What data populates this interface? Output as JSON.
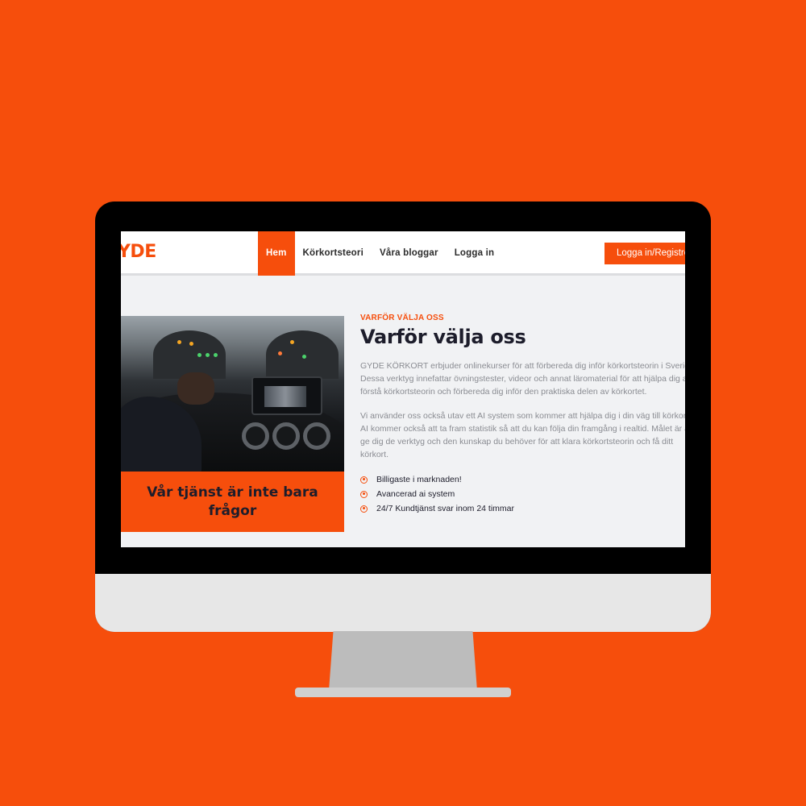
{
  "brand": {
    "logo_text": "YDE",
    "accent_color": "#f64e0c"
  },
  "nav": {
    "items": [
      {
        "label": "Hem",
        "active": true
      },
      {
        "label": "Körkortsteori",
        "active": false
      },
      {
        "label": "Våra bloggar",
        "active": false
      },
      {
        "label": "Logga in",
        "active": false
      }
    ],
    "cta_label": "Logga in/Registrera"
  },
  "hero": {
    "image_icon": "car-dashboard-photo",
    "card_text": "Vår tjänst är inte bara frågor"
  },
  "section": {
    "eyebrow": "VARFÖR VÄLJA OSS",
    "heading": "Varför välja oss",
    "paragraph1": "GYDE KÖRKORT erbjuder onlinekurser för att förbereda dig inför körkortsteorin i Sverige. Dessa verktyg innefattar övningstester, videor och annat läromaterial för att hjälpa dig att förstå körkortsteorin och förbereda dig inför den praktiska delen av körkortet.",
    "paragraph2": "Vi använder oss också utav ett AI system som kommer att hjälpa dig i din väg till körkortet. AI kommer också att ta fram statistik så att du kan följa din framgång i realtid. Målet är att ge dig de verktyg och den kunskap du behöver för att klara körkortsteorin och få ditt körkort.",
    "features": [
      "Billigaste i marknaden!",
      "Avancerad ai system",
      "24/7 Kundtjänst svar inom 24 timmar"
    ]
  }
}
